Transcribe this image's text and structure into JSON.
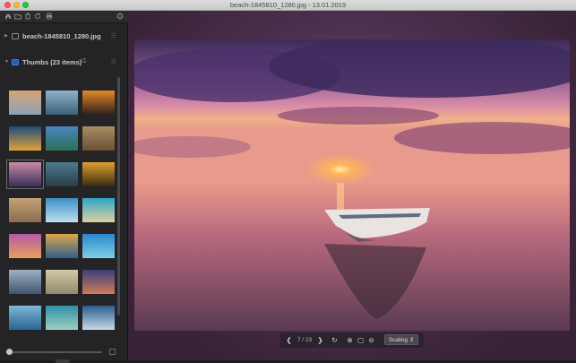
{
  "window": {
    "title": "beach-1845810_1280.jpg - 13.01.2019"
  },
  "sidebar": {
    "toolbar_icons": [
      "home-icon",
      "folder-icon",
      "trash-icon",
      "refresh-icon",
      "print-icon",
      "close-icon"
    ],
    "file_section": {
      "label": "beach-1845810_1280.jpg"
    },
    "thumbs_section": {
      "label": "Thumbs (23 items)"
    },
    "thumbnails": [
      {
        "name": "sunrise-sky",
        "colors": [
          "#d7a376",
          "#8aa3b7"
        ]
      },
      {
        "name": "beach-clouds",
        "colors": [
          "#8fb2cc",
          "#3c5f7a"
        ]
      },
      {
        "name": "rock-sunset",
        "colors": [
          "#e48a2a",
          "#2f1f1a"
        ]
      },
      {
        "name": "ocean-sunset",
        "colors": [
          "#1e4b7a",
          "#e3a33c"
        ]
      },
      {
        "name": "palm-beach",
        "colors": [
          "#4a86c0",
          "#2c6f55"
        ]
      },
      {
        "name": "coast-village",
        "colors": [
          "#a88c62",
          "#6b5136"
        ]
      },
      {
        "name": "boat-sunset",
        "colors": [
          "#c98aa5",
          "#3b2f5a"
        ]
      },
      {
        "name": "pier-dusk",
        "colors": [
          "#4c7c8c",
          "#2b3c49"
        ]
      },
      {
        "name": "golden-palm",
        "colors": [
          "#e0a030",
          "#3a2a10"
        ]
      },
      {
        "name": "sand-texture",
        "colors": [
          "#c4a27a",
          "#8a6c4c"
        ]
      },
      {
        "name": "wave-blue",
        "colors": [
          "#3c8fc6",
          "#bfe0ef"
        ]
      },
      {
        "name": "aerial-beach",
        "colors": [
          "#2ea6c7",
          "#e0cfa0"
        ]
      },
      {
        "name": "purple-sunset",
        "colors": [
          "#b35aa8",
          "#e7a05c"
        ]
      },
      {
        "name": "aerial-coast",
        "colors": [
          "#e0a84a",
          "#2e5f8c"
        ]
      },
      {
        "name": "turquoise-bay",
        "colors": [
          "#2c86d0",
          "#7fd0e0"
        ]
      },
      {
        "name": "surf-waves",
        "colors": [
          "#9fb0c2",
          "#3e5671"
        ]
      },
      {
        "name": "shell-sand",
        "colors": [
          "#d3c9a8",
          "#8f8a6c"
        ]
      },
      {
        "name": "dusk-shore",
        "colors": [
          "#3a3f7a",
          "#d07a5a"
        ]
      },
      {
        "name": "breaking-wave",
        "colors": [
          "#7fb6d9",
          "#2a6690"
        ]
      },
      {
        "name": "reef-aerial",
        "colors": [
          "#2f8fa8",
          "#9ed0c0"
        ]
      },
      {
        "name": "foam-shore",
        "colors": [
          "#2a5c8c",
          "#c8d8e8"
        ]
      }
    ]
  },
  "viewer": {
    "page_indicator": "7 / 23",
    "scaling_label": "Scaling ⇕",
    "icons": [
      "chevron-left-icon",
      "chevron-right-icon",
      "rotate-icon",
      "zoom-in-icon",
      "fit-icon",
      "zoom-out-icon"
    ]
  }
}
